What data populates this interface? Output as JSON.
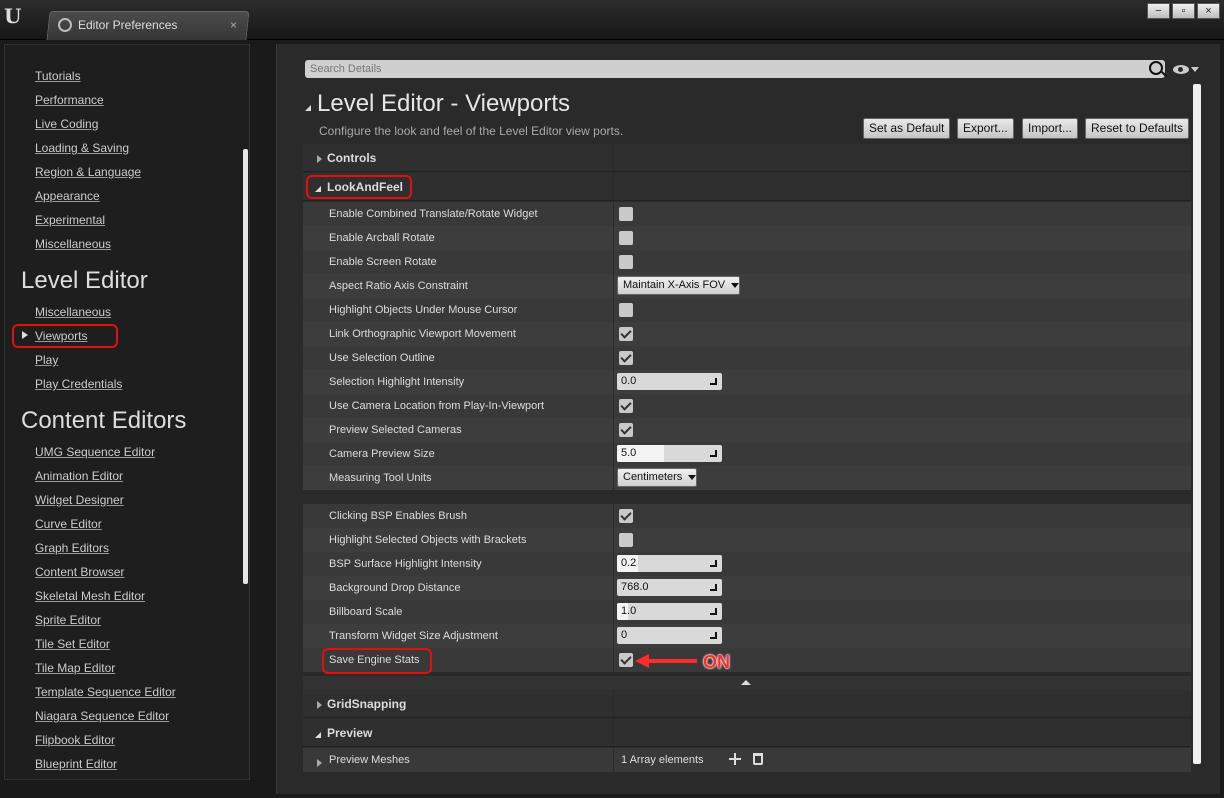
{
  "window": {
    "tab_title": "Editor Preferences",
    "tab_close": "×",
    "logo": "U",
    "buttons": [
      "−",
      "▫",
      "×"
    ]
  },
  "leftnav": {
    "general_items": [
      "Tutorials",
      "Performance",
      "Live Coding",
      "Loading & Saving",
      "Region & Language",
      "Appearance",
      "Experimental",
      "Miscellaneous"
    ],
    "sections": [
      {
        "title": "Level Editor",
        "items": [
          "Miscellaneous",
          "Viewports",
          "Play",
          "Play Credentials"
        ]
      },
      {
        "title": "Content Editors",
        "items": [
          "UMG Sequence Editor",
          "Animation Editor",
          "Widget Designer",
          "Curve Editor",
          "Graph Editors",
          "Content Browser",
          "Skeletal Mesh Editor",
          "Sprite Editor",
          "Tile Set Editor",
          "Tile Map Editor",
          "Template Sequence Editor",
          "Niagara Sequence Editor",
          "Flipbook Editor",
          "Blueprint Editor"
        ]
      }
    ],
    "selected": "Viewports"
  },
  "details": {
    "search_placeholder": "Search Details",
    "title": "Level Editor - Viewports",
    "description": "Configure the look and feel of the Level Editor view ports.",
    "buttons": {
      "set_default": "Set as Default",
      "export": "Export...",
      "import": "Import...",
      "reset": "Reset to Defaults"
    },
    "categories": {
      "controls": "Controls",
      "look_and_feel": "LookAndFeel",
      "grid_snapping": "GridSnapping",
      "preview": "Preview"
    },
    "look_and_feel_props": [
      {
        "label": "Enable Combined Translate/Rotate Widget",
        "type": "checkbox",
        "checked": false
      },
      {
        "label": "Enable Arcball Rotate",
        "type": "checkbox",
        "checked": false
      },
      {
        "label": "Enable Screen Rotate",
        "type": "checkbox",
        "checked": false
      },
      {
        "label": "Aspect Ratio Axis Constraint",
        "type": "combo",
        "value": "Maintain X-Axis FOV"
      },
      {
        "label": "Highlight Objects Under Mouse Cursor",
        "type": "checkbox",
        "checked": false
      },
      {
        "label": "Link Orthographic Viewport Movement",
        "type": "checkbox",
        "checked": true
      },
      {
        "label": "Use Selection Outline",
        "type": "checkbox",
        "checked": true
      },
      {
        "label": "Selection Highlight Intensity",
        "type": "number",
        "value": "0.0",
        "fill": 0.0
      },
      {
        "label": "Use Camera Location from Play-In-Viewport",
        "type": "checkbox",
        "checked": true
      },
      {
        "label": "Preview Selected Cameras",
        "type": "checkbox",
        "checked": true
      },
      {
        "label": "Camera Preview Size",
        "type": "number",
        "value": "5.0",
        "fill": 0.45
      },
      {
        "label": "Measuring Tool Units",
        "type": "combo",
        "value": "Centimeters"
      }
    ],
    "advanced_props": [
      {
        "label": "Clicking BSP Enables Brush",
        "type": "checkbox",
        "checked": true
      },
      {
        "label": "Highlight Selected Objects with Brackets",
        "type": "checkbox",
        "checked": false
      },
      {
        "label": "BSP Surface Highlight Intensity",
        "type": "number",
        "value": "0.2",
        "fill": 0.2
      },
      {
        "label": "Background Drop Distance",
        "type": "number",
        "value": "768.0",
        "fill": 0.0
      },
      {
        "label": "Billboard Scale",
        "type": "number",
        "value": "1.0",
        "fill": 0.1
      },
      {
        "label": "Transform Widget Size Adjustment",
        "type": "number",
        "value": "0",
        "fill": 0.0
      },
      {
        "label": "Save Engine Stats",
        "type": "checkbox",
        "checked": true
      }
    ],
    "preview_meshes": {
      "label": "Preview Meshes",
      "value": "1 Array elements"
    },
    "annotation": "ON"
  },
  "colors": {
    "highlight": "#e01010",
    "annotation": "#ff2a2a"
  }
}
